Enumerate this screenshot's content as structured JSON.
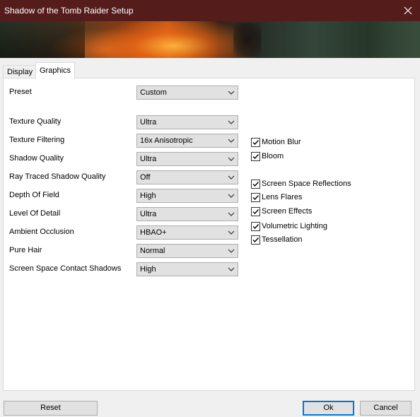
{
  "window": {
    "title": "Shadow of the Tomb Raider Setup"
  },
  "tabs": [
    {
      "label": "Display",
      "active": false
    },
    {
      "label": "Graphics",
      "active": true
    }
  ],
  "preset": {
    "label": "Preset",
    "value": "Custom"
  },
  "settings": [
    {
      "label": "Texture Quality",
      "value": "Ultra"
    },
    {
      "label": "Texture Filtering",
      "value": "16x Anisotropic"
    },
    {
      "label": "Shadow Quality",
      "value": "Ultra"
    },
    {
      "label": "Ray Traced Shadow Quality",
      "value": "Off"
    },
    {
      "label": "Depth Of Field",
      "value": "High"
    },
    {
      "label": "Level Of Detail",
      "value": "Ultra"
    },
    {
      "label": "Ambient Occlusion",
      "value": "HBAO+"
    },
    {
      "label": "Pure Hair",
      "value": "Normal"
    },
    {
      "label": "Screen Space Contact Shadows",
      "value": "High"
    }
  ],
  "effects": [
    {
      "label": "Motion Blur",
      "checked": true
    },
    {
      "label": "Bloom",
      "checked": true
    },
    {
      "label": "Screen Space Reflections",
      "checked": true
    },
    {
      "label": "Lens Flares",
      "checked": true
    },
    {
      "label": "Screen Effects",
      "checked": true
    },
    {
      "label": "Volumetric Lighting",
      "checked": true
    },
    {
      "label": "Tessellation",
      "checked": true
    }
  ],
  "buttons": {
    "reset": "Reset",
    "ok": "Ok",
    "cancel": "Cancel"
  },
  "colors": {
    "titlebar": "#551c1c",
    "accent": "#0078d7"
  }
}
